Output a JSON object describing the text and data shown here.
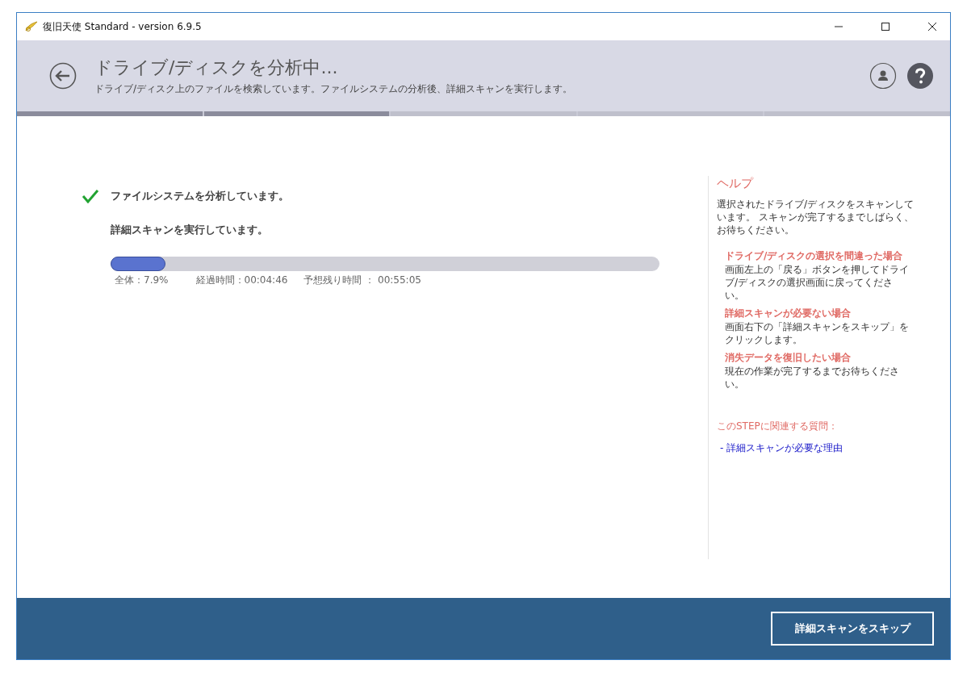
{
  "window": {
    "title": "復旧天使 Standard - version 6.9.5"
  },
  "header": {
    "title": "ドライブ/ディスクを分析中...",
    "subtitle": "ドライブ/ディスク上のファイルを検索しています。ファイルシステムの分析後、詳細スキャンを実行します。"
  },
  "steps": [
    {
      "done": true
    },
    {
      "done": true
    },
    {
      "done": false
    },
    {
      "done": false
    },
    {
      "done": false
    }
  ],
  "tasks": [
    {
      "label": "ファイルシステムを分析しています。",
      "checked": true
    },
    {
      "label": "詳細スキャンを実行しています。",
      "checked": false
    }
  ],
  "progress": {
    "level": 0.1,
    "overall": "全体：7.9%",
    "elapsed": "経過時間：00:04:46",
    "remaining": "予想残り時間 ： 00:55:05"
  },
  "help": {
    "title": "ヘルプ",
    "intro": "選択されたドライブ/ディスクをスキャンしています。 スキャンが完了するまでしばらく、お待ちください。",
    "sections": [
      {
        "heading": "ドライブ/ディスクの選択を間違った場合",
        "body": "画面左上の「戻る」ボタンを押してドライブ/ディスクの選択画面に戻ってください。"
      },
      {
        "heading": "詳細スキャンが必要ない場合",
        "body": "画面右下の「詳細スキャンをスキップ」をクリックします。"
      },
      {
        "heading": "消失データを復旧したい場合",
        "body": "現在の作業が完了するまでお待ちください。"
      }
    ],
    "faq_title": "このSTEPに関連する質問：",
    "faq_links": [
      "- 詳細スキャンが必要な理由"
    ]
  },
  "footer": {
    "button": "詳細スキャンをスキップ"
  }
}
